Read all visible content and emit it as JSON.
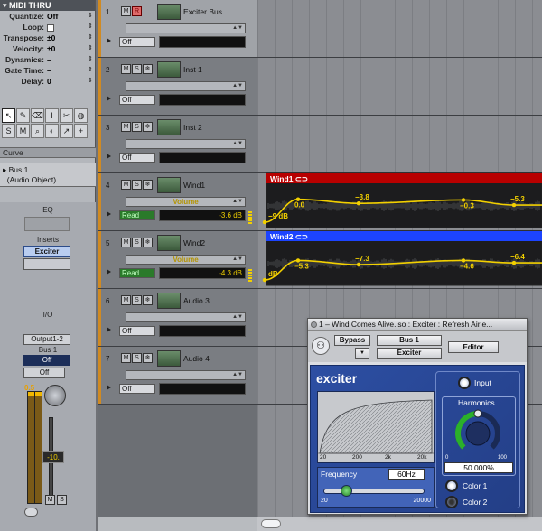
{
  "inspector": {
    "title": "MIDI THRU",
    "params": [
      {
        "label": "Quantize:",
        "value": "Off"
      },
      {
        "label": "Loop:",
        "value": ""
      },
      {
        "label": "Transpose:",
        "value": "±0"
      },
      {
        "label": "Velocity:",
        "value": "±0"
      },
      {
        "label": "Dynamics:",
        "value": "–"
      },
      {
        "label": "Gate Time:",
        "value": "–"
      },
      {
        "label": "Delay:",
        "value": "0"
      }
    ],
    "curve_label": "Curve",
    "bus_object": {
      "name": "Bus 1",
      "type": "(Audio Object)"
    },
    "channel_strip": {
      "eq_label": "EQ",
      "inserts_label": "Inserts",
      "insert_plugin": "Exciter",
      "io_label": "I/O",
      "output": "Output1-2",
      "bus": "Bus 1",
      "off1": "Off",
      "off2": "Off",
      "meter_peak": "0.5",
      "fader_value": "-10.",
      "mute_label": "M",
      "solo_label": "S"
    }
  },
  "tracks": [
    {
      "num": "1",
      "name": "Exciter Bus",
      "auto": "",
      "mode": "Off",
      "value": "",
      "rec": true
    },
    {
      "num": "2",
      "name": "Inst  1",
      "auto": "",
      "mode": "Off",
      "value": "",
      "rec": false
    },
    {
      "num": "3",
      "name": "Inst  2",
      "auto": "",
      "mode": "Off",
      "value": "",
      "rec": false
    },
    {
      "num": "4",
      "name": "Wind1",
      "auto": "Volume",
      "mode": "Read",
      "value": "-3.6 dB",
      "rec": false
    },
    {
      "num": "5",
      "name": "Wind2",
      "auto": "Volume",
      "mode": "Read",
      "value": "-4.3 dB",
      "rec": false
    },
    {
      "num": "6",
      "name": "Audio 3",
      "auto": "",
      "mode": "Off",
      "value": "",
      "rec": false
    },
    {
      "num": "7",
      "name": "Audio 4",
      "auto": "",
      "mode": "Off",
      "value": "",
      "rec": false
    }
  ],
  "regions": [
    {
      "name": "Wind1",
      "color": "#b80000",
      "points": [
        {
          "label": "−9 dB",
          "level": 0.05
        },
        {
          "label": "0.0",
          "level": 0.72
        },
        {
          "label": "−3.8",
          "level": 0.6
        },
        {
          "label": "−0.3",
          "level": 0.7
        },
        {
          "label": "−5.3",
          "level": 0.55
        }
      ]
    },
    {
      "name": "Wind2",
      "color": "#1c44ff",
      "points": [
        {
          "label": "dB",
          "level": 0.05
        },
        {
          "label": "−5.3",
          "level": 0.62
        },
        {
          "label": "−7.3",
          "level": 0.5
        },
        {
          "label": "−4.6",
          "level": 0.62
        },
        {
          "label": "−6.4",
          "level": 0.55
        }
      ]
    }
  ],
  "plugin": {
    "title": "1 – Wind Comes Alive.lso : Exciter : Refresh Airle...",
    "bypass_label": "Bypass",
    "bus_label": "Bus 1",
    "plugin_label": "Exciter",
    "editor_label": "Editor",
    "logo": "exciter",
    "input_label": "Input",
    "harmonics_label": "Harmonics",
    "harmonics_min": "0",
    "harmonics_max": "100",
    "harmonics_value": "50.000%",
    "harmonics_level": 0.5,
    "freq_label": "Frequency",
    "freq_value": "60Hz",
    "freq_min": "20",
    "freq_max": "20000",
    "graph_ticks": [
      "20",
      "200",
      "2k",
      "20k"
    ],
    "color1_label": "Color 1",
    "color2_label": "Color 2"
  },
  "colors": {
    "accent_yellow": "#f2d000",
    "plugin_blue": "#2d4fa3",
    "track_orange": "#d08a22"
  }
}
